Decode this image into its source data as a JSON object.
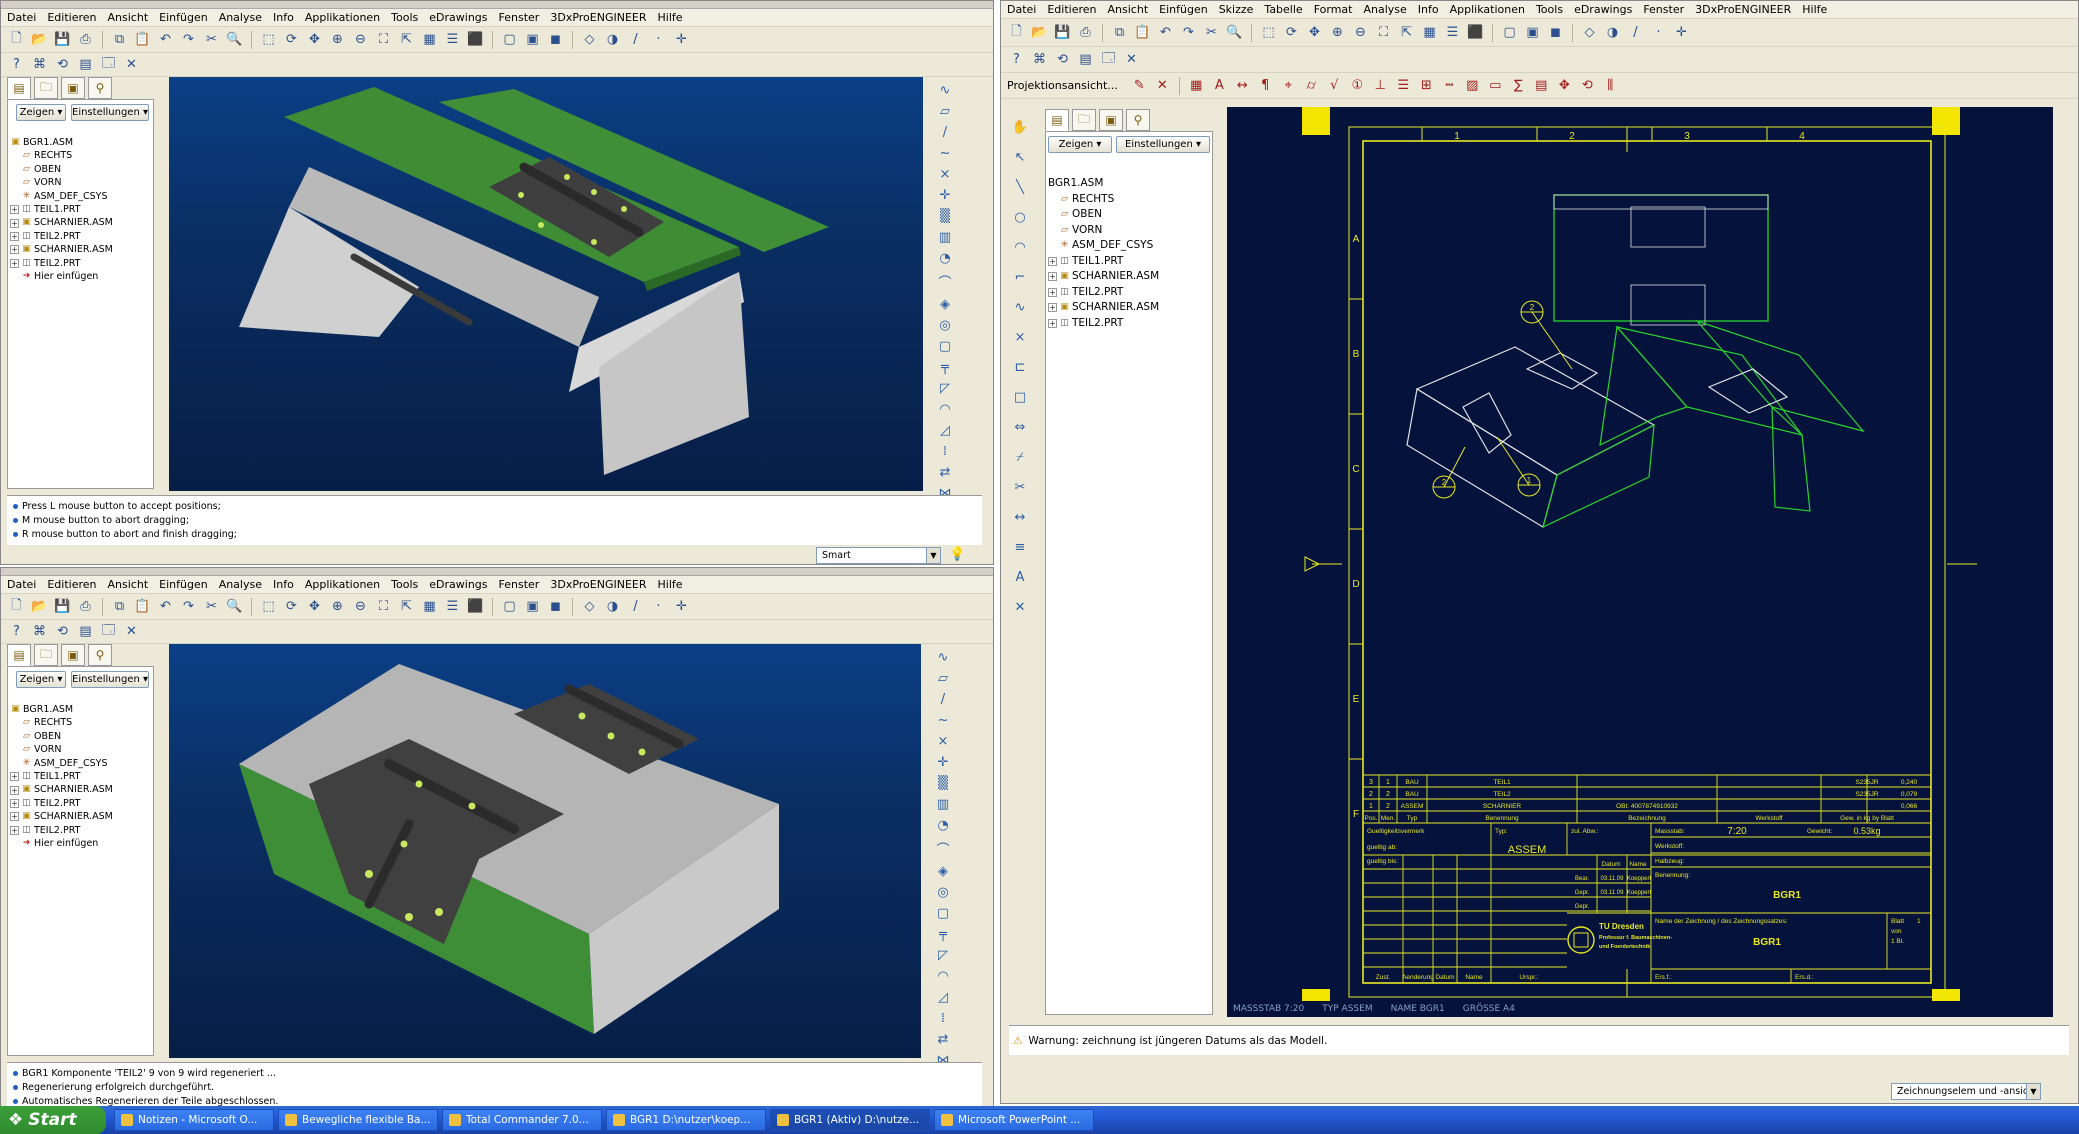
{
  "left_window": {
    "menu": [
      "Datei",
      "Editieren",
      "Ansicht",
      "Einfügen",
      "Analyse",
      "Info",
      "Applikationen",
      "Tools",
      "eDrawings",
      "Fenster",
      "3DxProENGINEER",
      "Hilfe"
    ],
    "nav_buttons": {
      "show": "Zeigen",
      "settings": "Einstellungen"
    },
    "tree": [
      {
        "label": "BGR1.ASM",
        "icon": "assembly-icon",
        "expander": false,
        "root": true
      },
      {
        "label": "RECHTS",
        "icon": "datum-plane-icon",
        "expander": false
      },
      {
        "label": "OBEN",
        "icon": "datum-plane-icon",
        "expander": false
      },
      {
        "label": "VORN",
        "icon": "datum-plane-icon",
        "expander": false
      },
      {
        "label": "ASM_DEF_CSYS",
        "icon": "csys-icon",
        "expander": false
      },
      {
        "label": "TEIL1.PRT",
        "icon": "part-icon",
        "expander": true
      },
      {
        "label": "SCHARNIER.ASM",
        "icon": "assembly-icon",
        "expander": true
      },
      {
        "label": "TEIL2.PRT",
        "icon": "part-icon",
        "expander": true
      },
      {
        "label": "SCHARNIER.ASM",
        "icon": "assembly-icon",
        "expander": true
      },
      {
        "label": "TEIL2.PRT",
        "icon": "part-icon",
        "expander": true
      },
      {
        "label": "Hier einfügen",
        "icon": "insert-here-icon",
        "expander": false
      }
    ],
    "smart_filter": "Smart"
  },
  "top_messages": [
    "Press L mouse button to accept positions;",
    "M mouse button to abort dragging;",
    "R mouse button to abort and finish dragging;"
  ],
  "bottom_messages": [
    "BGR1 Komponente 'TEIL2' 9 von 9 wird regeneriert ...",
    "Regenerierung erfolgreich durchgeführt.",
    "Automatisches Regenerieren der Teile abgeschlossen."
  ],
  "right_window": {
    "menu": [
      "Datei",
      "Editieren",
      "Ansicht",
      "Einfügen",
      "Skizze",
      "Tabelle",
      "Format",
      "Analyse",
      "Info",
      "Applikationen",
      "Tools",
      "eDrawings",
      "Fenster",
      "3DxProENGINEER",
      "Hilfe"
    ],
    "projection_label": "Projektionsansicht...",
    "nav_buttons": {
      "show": "Zeigen",
      "settings": "Einstellungen"
    },
    "tree": [
      {
        "label": "BGR1.ASM",
        "icon": "",
        "expander": false,
        "root": true
      },
      {
        "label": "RECHTS",
        "icon": "datum-plane-icon",
        "expander": false
      },
      {
        "label": "OBEN",
        "icon": "datum-plane-icon",
        "expander": false
      },
      {
        "label": "VORN",
        "icon": "datum-plane-icon",
        "expander": false
      },
      {
        "label": "ASM_DEF_CSYS",
        "icon": "csys-icon",
        "expander": false
      },
      {
        "label": "TEIL1.PRT",
        "icon": "part-icon",
        "expander": true
      },
      {
        "label": "SCHARNIER.ASM",
        "icon": "assembly-icon",
        "expander": true
      },
      {
        "label": "TEIL2.PRT",
        "icon": "part-icon",
        "expander": true
      },
      {
        "label": "SCHARNIER.ASM",
        "icon": "assembly-icon",
        "expander": true
      },
      {
        "label": "TEIL2.PRT",
        "icon": "part-icon",
        "expander": true
      }
    ],
    "drawing_status": [
      "MASSSTAB 7:20",
      "TYP ASSEM",
      "NAME BGR1",
      "GRÖSSE A4"
    ],
    "warning": "Warnung: zeichnung ist jüngeren Datums als das Modell.",
    "selection_filter": "Zeichnungselem und -ansic"
  },
  "drawing": {
    "col_labels": [
      "1",
      "2",
      "3",
      "4"
    ],
    "row_labels": [
      "A",
      "B",
      "C",
      "D",
      "E",
      "F"
    ],
    "balloons": [
      "2",
      "2",
      "1"
    ],
    "bom": [
      {
        "pos": "3",
        "qty": "1",
        "type": "BAU",
        "name": "TEIL1",
        "desc": "",
        "mat": "S235JR",
        "mass": "0,240"
      },
      {
        "pos": "2",
        "qty": "2",
        "type": "BAU",
        "name": "TEIL2",
        "desc": "",
        "mat": "S235JR",
        "mass": "0,079"
      },
      {
        "pos": "1",
        "qty": "2",
        "type": "ASSEM",
        "name": "SCHARNIER",
        "desc": "OBI: 4007874910932",
        "mat": "",
        "mass": "0,066"
      }
    ],
    "bom_head": [
      "Pos.",
      "Men.",
      "Typ",
      "Benennung",
      "Bezeichnung",
      "Werkstoff",
      "Gew. in kg by Blatt"
    ],
    "tb": {
      "surface": "Gueltigkeitsvermerk",
      "valid_from": "gueltig ab:",
      "valid_to": "gueltig bis:",
      "type_label": "Typ:",
      "type_value": "ASSEM",
      "abw": "zul. Abw.:",
      "scale_label": "Massstab:",
      "scale_value": "7:20",
      "weight_label": "Gewicht:",
      "weight_value": "0.53kg",
      "material_label": "Werkstoff:",
      "material_value": "Halbzeug:",
      "designation_label": "Benennung:",
      "designation_value": "BGR1",
      "date_head": "Datum",
      "name_head": "Name",
      "rows": [
        {
          "label": "Bear.",
          "date": "03.11.09",
          "name": "Koeppert"
        },
        {
          "label": "Gepr.",
          "date": "03.11.09",
          "name": "Koeppert"
        },
        {
          "label": "Gepr.",
          "date": "",
          "name": ""
        }
      ],
      "uni": "TU Dresden",
      "uni_sub1": "Professur f. Baumaschinen-",
      "uni_sub2": "und Foerdertechnik",
      "drawing_name_label": "Name der Zeichnung / des Zeichnungssatzes:",
      "drawing_name": "BGR1",
      "sheet_label": "Blatt",
      "sheet_value": "1",
      "von": "von",
      "bl": "1 Bl.",
      "ers_f": "Ers.f.:",
      "ers_d": "Ers.d.:",
      "footer": [
        "Zust.",
        "Aenderung",
        "Datum",
        "Name",
        "Urspr.:"
      ]
    }
  },
  "taskbar": {
    "start": "Start",
    "tasks": [
      {
        "label": "Notizen - Microsoft O...",
        "active": false
      },
      {
        "label": "Bewegliche flexible Ba...",
        "active": false
      },
      {
        "label": "Total Commander 7.0...",
        "active": false
      },
      {
        "label": "BGR1 D:\\nutzer\\koep...",
        "active": false
      },
      {
        "label": "BGR1 (Aktiv) D:\\nutze...",
        "active": true
      },
      {
        "label": "Microsoft PowerPoint ...",
        "active": false
      }
    ]
  },
  "colors": {
    "viewport_top": "#0b3f86",
    "model_green": "#3a8f3a",
    "model_grey": "#b8b8b8",
    "drawing_bg": "#04123c",
    "drawing_yellow": "#e8e820",
    "drawing_green": "#2bd42b"
  }
}
